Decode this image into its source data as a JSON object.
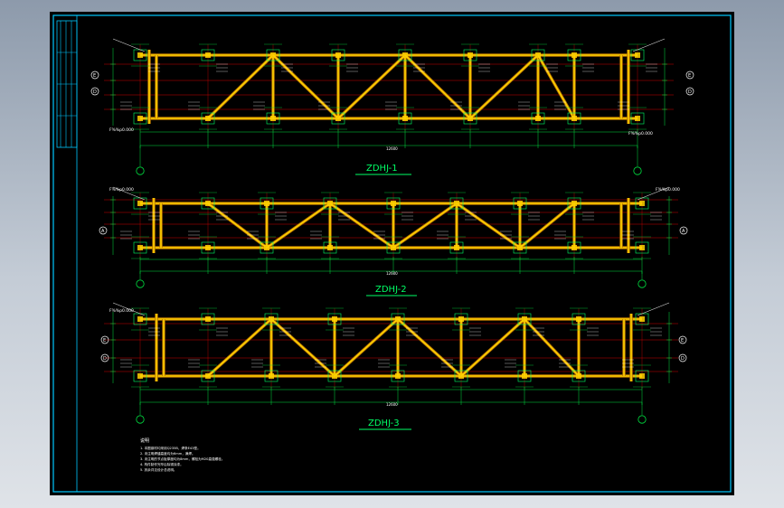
{
  "app": {
    "background": "#a9b5c3",
    "sheet_color": "#000000",
    "frame_color": "#00c8ff"
  },
  "colors": {
    "beam": "#ffd200",
    "gridline": "#d10000",
    "dim": "#00e040",
    "text": "#ffffff",
    "title": "#00ff66",
    "detail": "#00ff66"
  },
  "trusses": [
    {
      "title": "ZDHJ-1",
      "left_axes": [
        "E",
        "D"
      ],
      "right_axes": [
        "E",
        "D"
      ],
      "scale_label_left": "F%%p0.000",
      "scale_label_right": "F%%p0.000",
      "overall_dim": "12600"
    },
    {
      "title": "ZDHJ-2",
      "left_axes": [
        "A"
      ],
      "right_axes": [
        "A"
      ],
      "scale_label_left": "F%%p0.000",
      "scale_label_right": "F%%p0.000",
      "overall_dim": "12600"
    },
    {
      "title": "ZDHJ-3",
      "left_axes": [
        "E",
        "D"
      ],
      "right_axes": [
        "E",
        "D"
      ],
      "scale_label_left": "F%%p0.000",
      "scale_label_right": "",
      "overall_dim": "12600"
    }
  ],
  "notes": {
    "heading": "说明",
    "lines": [
      "1. 本图钢材均采用Q235B，焊条E43型。",
      "2. 未注明焊缝高度均为6mm，满焊。",
      "3. 未注明的节点板厚度均为8mm，螺栓为M20高强螺栓。",
      "4. 构件制作完毕后除锈涂漆。",
      "5. 其余详见设计总说明。"
    ]
  }
}
